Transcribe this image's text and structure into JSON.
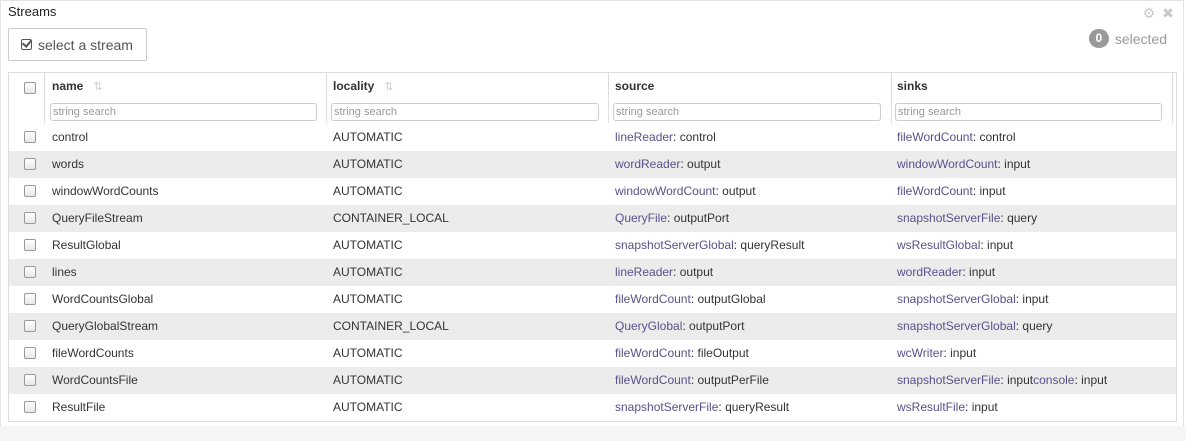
{
  "panel": {
    "title": "Streams",
    "select_label": "select a stream",
    "selected_count": "0",
    "selected_label": "selected"
  },
  "columns": {
    "name": "name",
    "locality": "locality",
    "source": "source",
    "sinks": "sinks"
  },
  "filter_placeholder": "string search",
  "rows": [
    {
      "name": "control",
      "locality": "AUTOMATIC",
      "source_op": "lineReader",
      "source_port": "control",
      "sinks": [
        {
          "op": "fileWordCount",
          "port": "control"
        }
      ]
    },
    {
      "name": "words",
      "locality": "AUTOMATIC",
      "source_op": "wordReader",
      "source_port": "output",
      "sinks": [
        {
          "op": "windowWordCount",
          "port": "input"
        }
      ]
    },
    {
      "name": "windowWordCounts",
      "locality": "AUTOMATIC",
      "source_op": "windowWordCount",
      "source_port": "output",
      "sinks": [
        {
          "op": "fileWordCount",
          "port": "input"
        }
      ]
    },
    {
      "name": "QueryFileStream",
      "locality": "CONTAINER_LOCAL",
      "source_op": "QueryFile",
      "source_port": "outputPort",
      "sinks": [
        {
          "op": "snapshotServerFile",
          "port": "query"
        }
      ]
    },
    {
      "name": "ResultGlobal",
      "locality": "AUTOMATIC",
      "source_op": "snapshotServerGlobal",
      "source_port": "queryResult",
      "sinks": [
        {
          "op": "wsResultGlobal",
          "port": "input"
        }
      ]
    },
    {
      "name": "lines",
      "locality": "AUTOMATIC",
      "source_op": "lineReader",
      "source_port": "output",
      "sinks": [
        {
          "op": "wordReader",
          "port": "input"
        }
      ]
    },
    {
      "name": "WordCountsGlobal",
      "locality": "AUTOMATIC",
      "source_op": "fileWordCount",
      "source_port": "outputGlobal",
      "sinks": [
        {
          "op": "snapshotServerGlobal",
          "port": "input"
        }
      ]
    },
    {
      "name": "QueryGlobalStream",
      "locality": "CONTAINER_LOCAL",
      "source_op": "QueryGlobal",
      "source_port": "outputPort",
      "sinks": [
        {
          "op": "snapshotServerGlobal",
          "port": "query"
        }
      ]
    },
    {
      "name": "fileWordCounts",
      "locality": "AUTOMATIC",
      "source_op": "fileWordCount",
      "source_port": "fileOutput",
      "sinks": [
        {
          "op": "wcWriter",
          "port": "input"
        }
      ]
    },
    {
      "name": "WordCountsFile",
      "locality": "AUTOMATIC",
      "source_op": "fileWordCount",
      "source_port": "outputPerFile",
      "sinks": [
        {
          "op": "snapshotServerFile",
          "port": "input"
        },
        {
          "op": "console",
          "port": "input"
        }
      ]
    },
    {
      "name": "ResultFile",
      "locality": "AUTOMATIC",
      "source_op": "snapshotServerFile",
      "source_port": "queryResult",
      "sinks": [
        {
          "op": "wsResultFile",
          "port": "input"
        }
      ]
    }
  ]
}
